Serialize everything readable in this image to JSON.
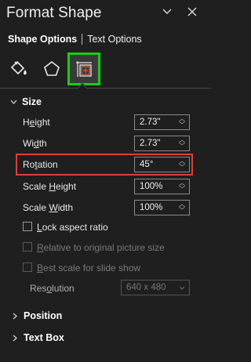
{
  "pane": {
    "title": "Format Shape",
    "tabs": [
      {
        "label": "Shape Options",
        "active": true
      },
      {
        "label": "Text Options",
        "active": false
      }
    ],
    "icons": [
      "fill-line-icon",
      "effects-pentagon-icon",
      "size-properties-icon"
    ]
  },
  "size_section": {
    "header": "Size",
    "expanded": true,
    "fields": [
      {
        "label_pre": "H",
        "label_u": "e",
        "label_post": "ight",
        "value": "2.73\""
      },
      {
        "label_pre": "Wi",
        "label_u": "d",
        "label_post": "th",
        "value": "2.73\""
      },
      {
        "label_pre": "Ro",
        "label_u": "t",
        "label_post": "ation",
        "value": "45°"
      },
      {
        "label_pre": "Scale ",
        "label_u": "H",
        "label_post": "eight",
        "value": "100%"
      },
      {
        "label_pre": "Scale ",
        "label_u": "W",
        "label_post": "idth",
        "value": "100%"
      }
    ],
    "checkboxes": [
      {
        "label_pre": "",
        "label_u": "L",
        "label_post": "ock aspect ratio",
        "checked": false,
        "enabled": true
      },
      {
        "label_pre": "",
        "label_u": "R",
        "label_post": "elative to original picture size",
        "checked": false,
        "enabled": false
      },
      {
        "label_pre": "",
        "label_u": "B",
        "label_post": "est scale for slide show",
        "checked": false,
        "enabled": false
      }
    ],
    "resolution": {
      "label_pre": "Res",
      "label_u": "o",
      "label_post": "lution",
      "value": "640 x 480",
      "enabled": false
    }
  },
  "collapsed_sections": [
    {
      "header": "Position"
    },
    {
      "header": "Text Box"
    }
  ],
  "colors": {
    "background": "#1f1f1f",
    "selected_icon_outline": "#15d10f",
    "rotation_highlight": "#e63b3b"
  }
}
